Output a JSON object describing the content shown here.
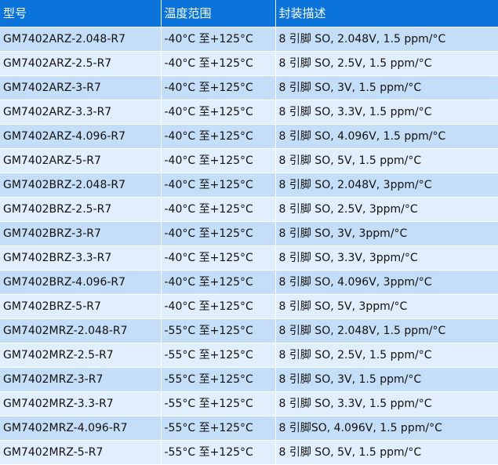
{
  "colors": {
    "header_bg": "#0A74DA",
    "header_text": "#ffffff",
    "row_odd": "#C5DEF7",
    "row_even": "#E1EEFB"
  },
  "headers": [
    "型号",
    "温度范围",
    "封装描述"
  ],
  "rows": [
    [
      "GM7402ARZ-2.048-R7",
      "-40°C 至+125°C",
      "8 引脚 SO, 2.048V, 1.5 ppm/°C"
    ],
    [
      "GM7402ARZ-2.5-R7",
      "-40°C 至+125°C",
      "8 引脚 SO, 2.5V, 1.5 ppm/°C"
    ],
    [
      "GM7402ARZ-3-R7",
      "-40°C 至+125°C",
      "8 引脚 SO, 3V, 1.5 ppm/°C"
    ],
    [
      "GM7402ARZ-3.3-R7",
      "-40°C 至+125°C",
      "8 引脚 SO, 3.3V, 1.5 ppm/°C"
    ],
    [
      "GM7402ARZ-4.096-R7",
      "-40°C 至+125°C",
      "8 引脚 SO, 4.096V, 1.5 ppm/°C"
    ],
    [
      "GM7402ARZ-5-R7",
      "-40°C 至+125°C",
      "8 引脚 SO, 5V, 1.5 ppm/°C"
    ],
    [
      "GM7402BRZ-2.048-R7",
      "-40°C 至+125°C",
      "8 引脚 SO, 2.048V, 3ppm/°C"
    ],
    [
      "GM7402BRZ-2.5-R7",
      "-40°C 至+125°C",
      "8 引脚 SO, 2.5V, 3ppm/°C"
    ],
    [
      "GM7402BRZ-3-R7",
      "-40°C 至+125°C",
      "8 引脚 SO, 3V, 3ppm/°C"
    ],
    [
      "GM7402BRZ-3.3-R7",
      "-40°C 至+125°C",
      "8 引脚 SO, 3.3V, 3ppm/°C"
    ],
    [
      "GM7402BRZ-4.096-R7",
      "-40°C 至+125°C",
      "8 引脚 SO, 4.096V, 3ppm/°C"
    ],
    [
      "GM7402BRZ-5-R7",
      "-40°C 至+125°C",
      "8 引脚 SO, 5V, 3ppm/°C"
    ],
    [
      "GM7402MRZ-2.048-R7",
      "-55°C 至+125°C",
      "8 引脚 SO, 2.048V, 1.5 ppm/°C"
    ],
    [
      "GM7402MRZ-2.5-R7",
      "-55°C 至+125°C",
      "8 引脚 SO, 2.5V, 1.5 ppm/°C"
    ],
    [
      "GM7402MRZ-3-R7",
      "-55°C 至+125°C",
      "8 引脚 SO, 3V, 1.5 ppm/°C"
    ],
    [
      "GM7402MRZ-3.3-R7",
      "-55°C 至+125°C",
      "8 引脚 SO, 3.3V, 1.5 ppm/°C"
    ],
    [
      "GM7402MRZ-4.096-R7",
      "-55°C 至+125°C",
      "8 引脚SO, 4.096V, 1.5 ppm/°C"
    ],
    [
      "GM7402MRZ-5-R7",
      "-55°C 至+125°C",
      "8 引脚 SO, 5V, 1.5 ppm/°C"
    ]
  ]
}
